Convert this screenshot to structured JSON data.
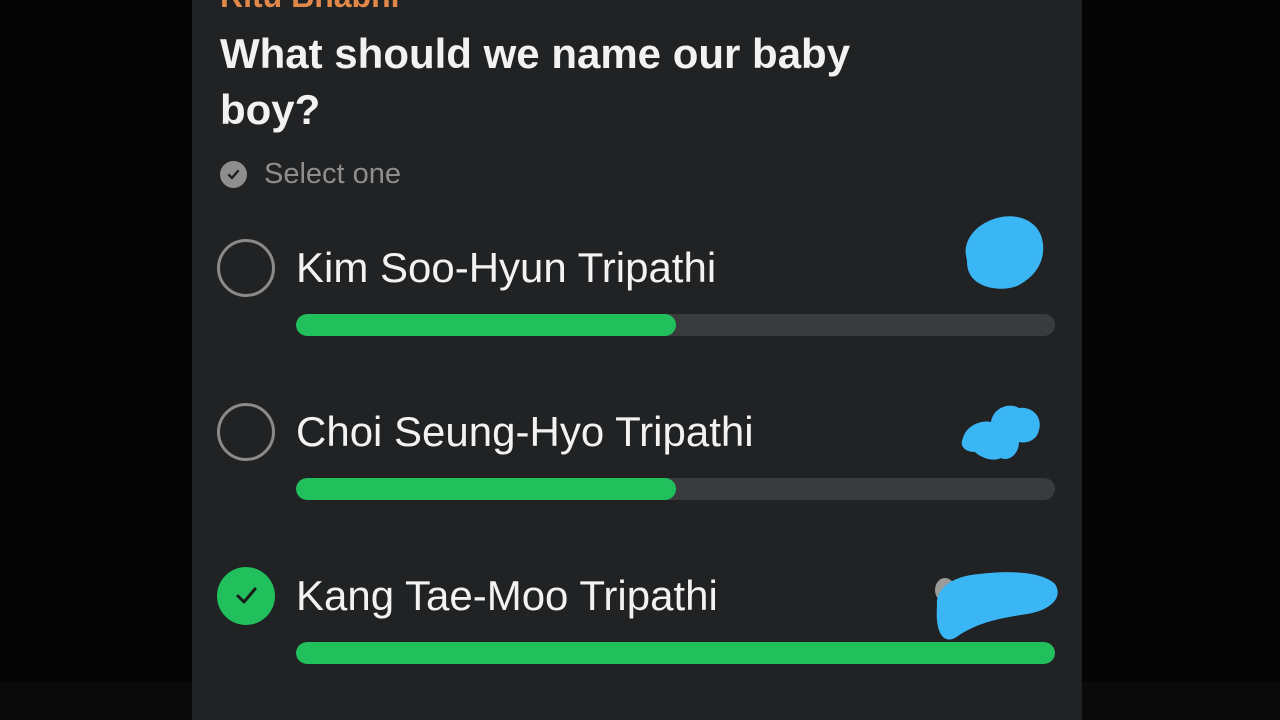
{
  "poll": {
    "sender": "Ritu Bhabhi",
    "question": "What should we name our baby boy?",
    "hint": "Select one",
    "hint_icon": "check-circle-icon",
    "options": [
      {
        "label": "Kim Soo-Hyun Tripathi",
        "selected": false,
        "vote_fraction": 0.5
      },
      {
        "label": "Choi Seung-Hyo Tripathi",
        "selected": false,
        "vote_fraction": 0.5
      },
      {
        "label": "Kang Tae-Moo Tripathi",
        "selected": true,
        "vote_fraction": 1.0
      }
    ]
  },
  "colors": {
    "background": "#000000",
    "card": "#202224",
    "sender": "#e0884a",
    "text": "#f2f2f2",
    "muted": "#8e8e8e",
    "accent_green": "#22c05c",
    "track": "#393b3d",
    "avatar_scribble": "#3bb6f5"
  }
}
